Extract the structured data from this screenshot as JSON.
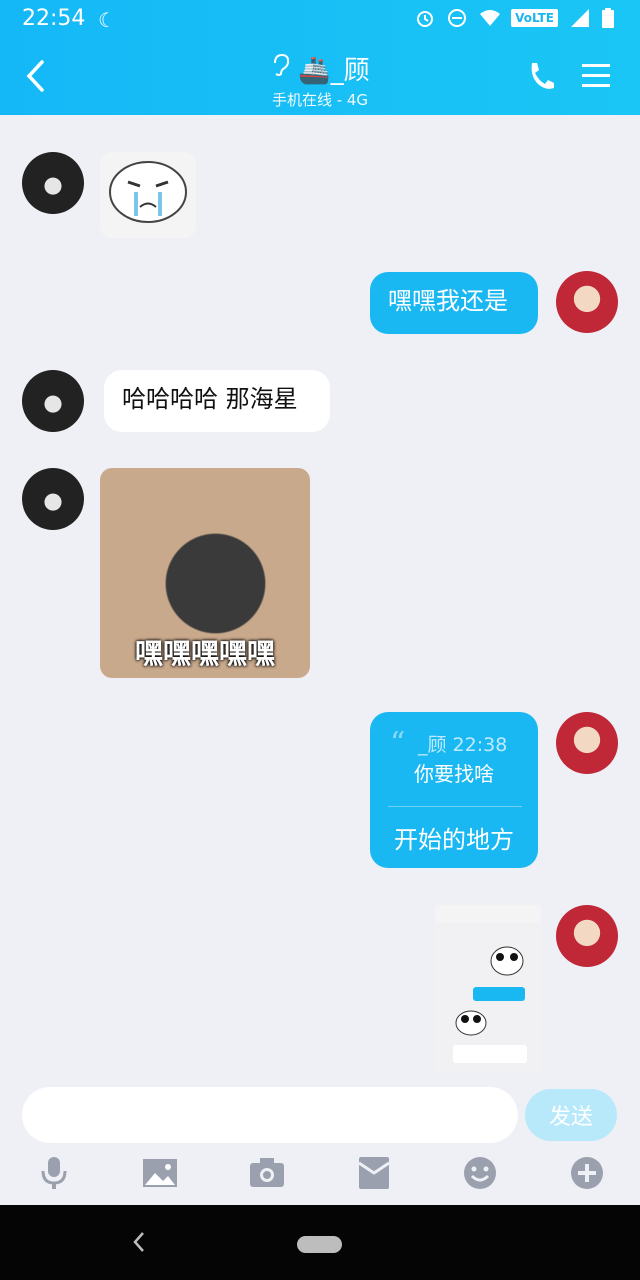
{
  "status_bar": {
    "time": "22:54",
    "network": "VoLTE"
  },
  "header": {
    "title": "🚢_顾",
    "subtitle": "手机在线 - 4G"
  },
  "messages": [
    {
      "side": "left",
      "type": "sticker",
      "name": "crying-sticker"
    },
    {
      "side": "right",
      "type": "text",
      "text": "嘿嘿我还是"
    },
    {
      "side": "left",
      "type": "text",
      "text": "哈哈哈哈 那海星"
    },
    {
      "side": "left",
      "type": "image",
      "caption": "嘿嘿嘿嘿嘿"
    },
    {
      "side": "right",
      "type": "quote",
      "quote_author_time": "_顾 22:38",
      "quote_text": "你要找啥",
      "text": "开始的地方"
    },
    {
      "side": "right",
      "type": "screenshot"
    }
  ],
  "input": {
    "placeholder": "",
    "send_label": "发送"
  },
  "toolbar": [
    "mic-icon",
    "image-icon",
    "camera-icon",
    "red-packet-icon",
    "emoji-icon",
    "plus-icon"
  ],
  "colors": {
    "accent": "#1ab8f2",
    "background": "#eef0f5"
  }
}
